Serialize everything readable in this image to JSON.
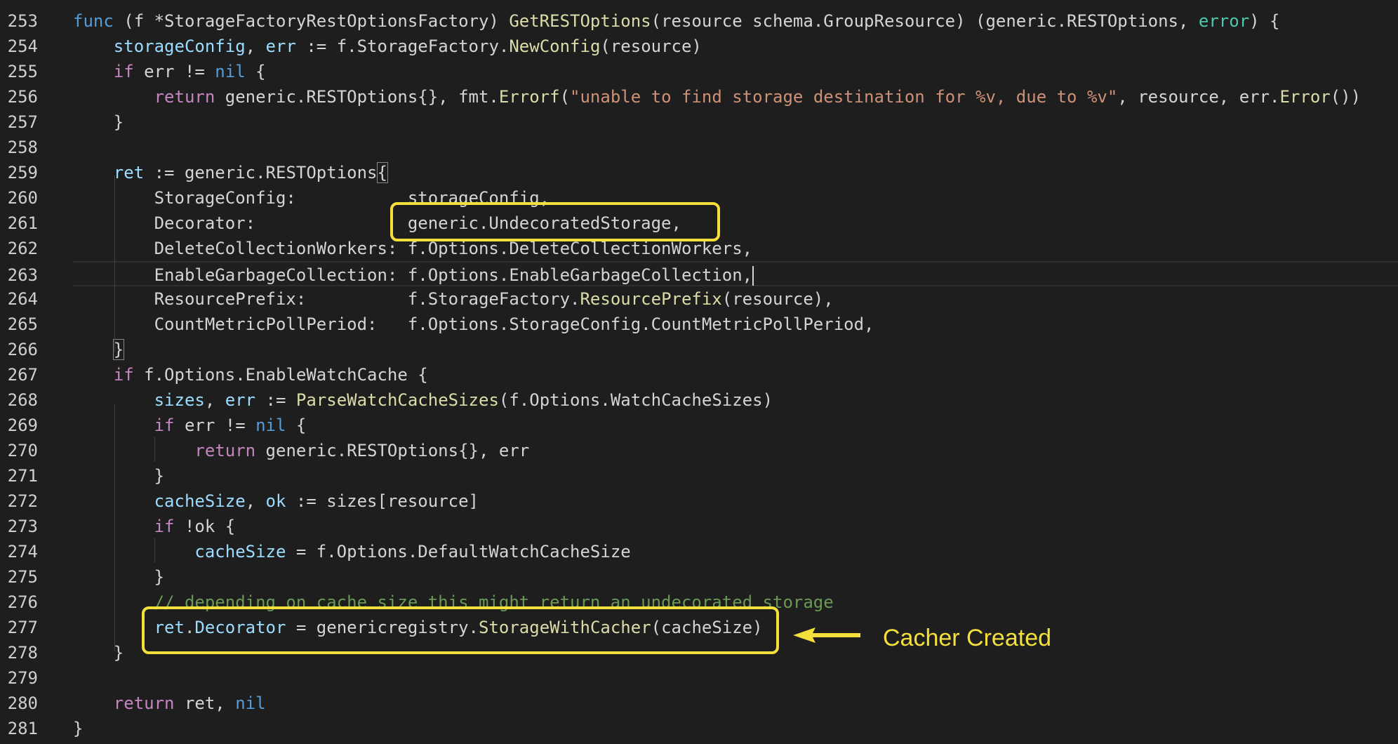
{
  "editor": {
    "lines": [
      {
        "num": "253",
        "tokens": [
          [
            "func",
            "t-kb"
          ],
          [
            " (f ",
            "t-pl"
          ],
          [
            "*",
            "t-pl"
          ],
          [
            "StorageFactoryRestOptionsFactory",
            "t-pl"
          ],
          [
            ") ",
            "t-pl"
          ],
          [
            "GetRESTOptions",
            "t-fn"
          ],
          [
            "(resource schema.GroupResource) (generic.RESTOptions, ",
            "t-pl"
          ],
          [
            "error",
            "t-ty"
          ],
          [
            ") {",
            "t-pl"
          ]
        ]
      },
      {
        "num": "254",
        "tokens": [
          [
            "    ",
            "t-pl"
          ],
          [
            "storageConfig",
            "t-var"
          ],
          [
            ", ",
            "t-pl"
          ],
          [
            "err",
            "t-var"
          ],
          [
            " := f.StorageFactory.",
            "t-pl"
          ],
          [
            "NewConfig",
            "t-fn"
          ],
          [
            "(resource)",
            "t-pl"
          ]
        ]
      },
      {
        "num": "255",
        "tokens": [
          [
            "    ",
            "t-pl"
          ],
          [
            "if",
            "t-kw"
          ],
          [
            " err != ",
            "t-pl"
          ],
          [
            "nil",
            "t-kb"
          ],
          [
            " {",
            "t-pl"
          ]
        ]
      },
      {
        "num": "256",
        "tokens": [
          [
            "        ",
            "t-pl"
          ],
          [
            "return",
            "t-kw"
          ],
          [
            " generic.RESTOptions{}, fmt.",
            "t-pl"
          ],
          [
            "Errorf",
            "t-fn"
          ],
          [
            "(",
            "t-pl"
          ],
          [
            "\"unable to find storage destination for %v, due to %v\"",
            "t-str"
          ],
          [
            ", resource, err.",
            "t-pl"
          ],
          [
            "Error",
            "t-fn"
          ],
          [
            "())",
            "t-pl"
          ]
        ]
      },
      {
        "num": "257",
        "tokens": [
          [
            "    }",
            "t-pl"
          ]
        ]
      },
      {
        "num": "258",
        "tokens": []
      },
      {
        "num": "259",
        "tokens": [
          [
            "    ",
            "t-pl"
          ],
          [
            "ret",
            "t-var"
          ],
          [
            " := generic.RESTOptions",
            "t-pl"
          ],
          [
            "{",
            "bracket-match"
          ]
        ]
      },
      {
        "num": "260",
        "tokens": [
          [
            "        StorageConfig:           storageConfig,",
            "t-pl"
          ]
        ]
      },
      {
        "num": "261",
        "tokens": [
          [
            "        Decorator:               generic.UndecoratedStorage,",
            "t-pl"
          ]
        ]
      },
      {
        "num": "262",
        "tokens": [
          [
            "        DeleteCollectionWorkers: f.Options.DeleteCollectionWorkers,",
            "t-pl"
          ]
        ]
      },
      {
        "num": "263",
        "tokens": [
          [
            "        EnableGarbageCollection: f.Options.EnableGarbageCollection,",
            "t-pl"
          ]
        ],
        "current": true
      },
      {
        "num": "264",
        "tokens": [
          [
            "        ResourcePrefix:          f.StorageFactory.",
            "t-pl"
          ],
          [
            "ResourcePrefix",
            "t-fn"
          ],
          [
            "(resource),",
            "t-pl"
          ]
        ]
      },
      {
        "num": "265",
        "tokens": [
          [
            "        CountMetricPollPeriod:   f.Options.StorageConfig.CountMetricPollPeriod,",
            "t-pl"
          ]
        ]
      },
      {
        "num": "266",
        "tokens": [
          [
            "    ",
            "t-pl"
          ],
          [
            "}",
            "bracket-match"
          ]
        ]
      },
      {
        "num": "267",
        "tokens": [
          [
            "    ",
            "t-pl"
          ],
          [
            "if",
            "t-kw"
          ],
          [
            " f.Options.EnableWatchCache {",
            "t-pl"
          ]
        ]
      },
      {
        "num": "268",
        "tokens": [
          [
            "        ",
            "t-pl"
          ],
          [
            "sizes",
            "t-var"
          ],
          [
            ", ",
            "t-pl"
          ],
          [
            "err",
            "t-var"
          ],
          [
            " := ",
            "t-pl"
          ],
          [
            "ParseWatchCacheSizes",
            "t-fn"
          ],
          [
            "(f.Options.WatchCacheSizes)",
            "t-pl"
          ]
        ]
      },
      {
        "num": "269",
        "tokens": [
          [
            "        ",
            "t-pl"
          ],
          [
            "if",
            "t-kw"
          ],
          [
            " err != ",
            "t-pl"
          ],
          [
            "nil",
            "t-kb"
          ],
          [
            " {",
            "t-pl"
          ]
        ]
      },
      {
        "num": "270",
        "tokens": [
          [
            "            ",
            "t-pl"
          ],
          [
            "return",
            "t-kw"
          ],
          [
            " generic.RESTOptions{}, err",
            "t-pl"
          ]
        ]
      },
      {
        "num": "271",
        "tokens": [
          [
            "        }",
            "t-pl"
          ]
        ]
      },
      {
        "num": "272",
        "tokens": [
          [
            "        ",
            "t-pl"
          ],
          [
            "cacheSize",
            "t-var"
          ],
          [
            ", ",
            "t-pl"
          ],
          [
            "ok",
            "t-var"
          ],
          [
            " := sizes[resource]",
            "t-pl"
          ]
        ]
      },
      {
        "num": "273",
        "tokens": [
          [
            "        ",
            "t-pl"
          ],
          [
            "if",
            "t-kw"
          ],
          [
            " !ok {",
            "t-pl"
          ]
        ]
      },
      {
        "num": "274",
        "tokens": [
          [
            "            ",
            "t-pl"
          ],
          [
            "cacheSize",
            "t-var"
          ],
          [
            " = f.Options.DefaultWatchCacheSize",
            "t-pl"
          ]
        ]
      },
      {
        "num": "275",
        "tokens": [
          [
            "        }",
            "t-pl"
          ]
        ]
      },
      {
        "num": "276",
        "tokens": [
          [
            "        ",
            "t-pl"
          ],
          [
            "// depending on cache size this might return an undecorated storage",
            "t-cm"
          ]
        ]
      },
      {
        "num": "277",
        "tokens": [
          [
            "        ",
            "t-pl"
          ],
          [
            "ret",
            "t-var"
          ],
          [
            ".",
            "t-pl"
          ],
          [
            "Decorator",
            "t-var"
          ],
          [
            " = genericregistry.",
            "t-pl"
          ],
          [
            "StorageWithCacher",
            "t-fn"
          ],
          [
            "(cacheSize)",
            "t-pl"
          ]
        ]
      },
      {
        "num": "278",
        "tokens": [
          [
            "    }",
            "t-pl"
          ]
        ]
      },
      {
        "num": "279",
        "tokens": []
      },
      {
        "num": "280",
        "tokens": [
          [
            "    ",
            "t-pl"
          ],
          [
            "return",
            "t-kw"
          ],
          [
            " ret, ",
            "t-pl"
          ],
          [
            "nil",
            "t-kb"
          ]
        ]
      },
      {
        "num": "281",
        "tokens": [
          [
            "}",
            "t-pl"
          ]
        ]
      }
    ]
  },
  "annotation": {
    "label": "Cacher Created",
    "color": "#f3e03b"
  }
}
